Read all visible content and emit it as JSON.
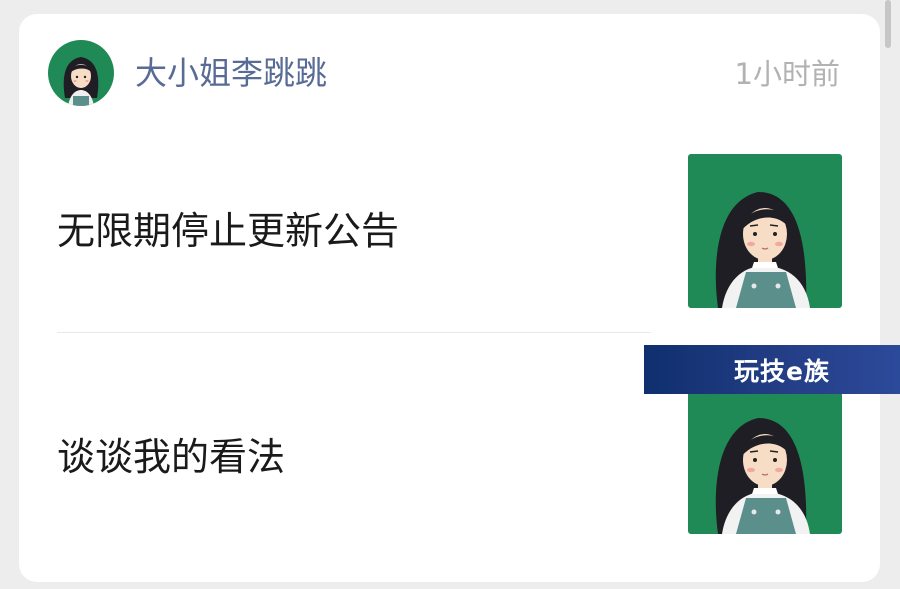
{
  "author": {
    "name": "大小姐李跳跳",
    "avatar_icon": "girl-avatar-icon"
  },
  "post_time": "1小时前",
  "articles": [
    {
      "title": "无限期停止更新公告",
      "thumbnail_icon": "girl-illustration-icon"
    },
    {
      "title": "谈谈我的看法",
      "thumbnail_icon": "girl-illustration-icon"
    }
  ],
  "watermark": {
    "text": "玩技e族"
  },
  "colors": {
    "accent_name": "#576b95",
    "thumb_bg": "#1f8a55",
    "card_bg": "#ffffff",
    "page_bg": "#ededed",
    "time": "#b2b2b2"
  }
}
